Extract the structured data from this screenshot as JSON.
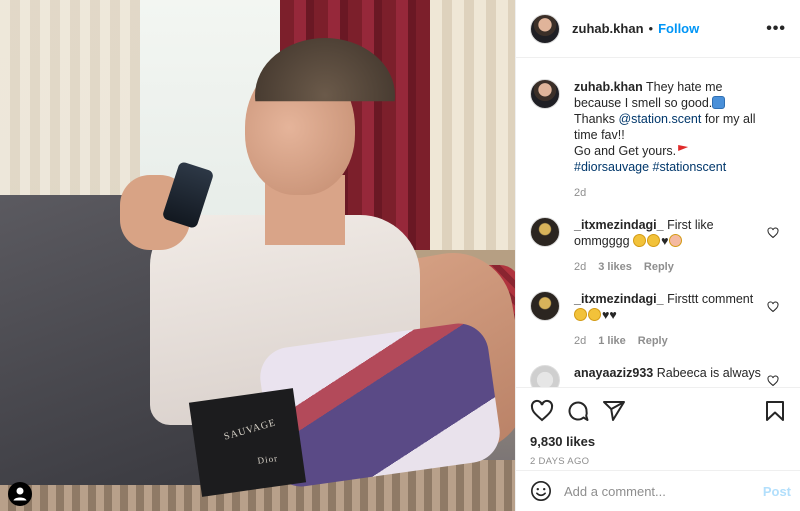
{
  "post": {
    "username": "zuhab.khan",
    "follow_label": "Follow",
    "separator": "•",
    "more_label": "•••"
  },
  "caption": {
    "username": "zuhab.khan",
    "line1": "They hate me because I smell so good.",
    "line2_prefix": "Thanks ",
    "mention": "@station.scent",
    "line2_suffix": " for my all time fav!!",
    "line3": "Go and Get yours.",
    "hashtags": "#diorsauvage #stationscent",
    "time": "2d"
  },
  "comments": [
    {
      "username": "_itxmezindagi_",
      "text": "First like ommgggg",
      "time": "2d",
      "likes": "3 likes",
      "reply": "Reply"
    },
    {
      "username": "_itxmezindagi_",
      "text": "Firsttt comment",
      "time": "2d",
      "likes": "1 like",
      "reply": "Reply"
    },
    {
      "username": "anayaaziz933",
      "text": "Rabeeca is always"
    }
  ],
  "photo": {
    "box_brand": "SAUVAGE",
    "box_maker": "Dior"
  },
  "stats": {
    "likes": "9,830 likes",
    "ago": "2 DAYS AGO"
  },
  "composer": {
    "placeholder": "Add a comment...",
    "post_label": "Post"
  },
  "icons": [
    "heart-icon",
    "comment-icon",
    "share-icon",
    "bookmark-icon",
    "emoji-icon",
    "more-icon",
    "user-tag-icon"
  ],
  "colors": {
    "link": "#0095f6",
    "post_disabled": "#b2dffc",
    "muted": "#8e8e8e"
  }
}
